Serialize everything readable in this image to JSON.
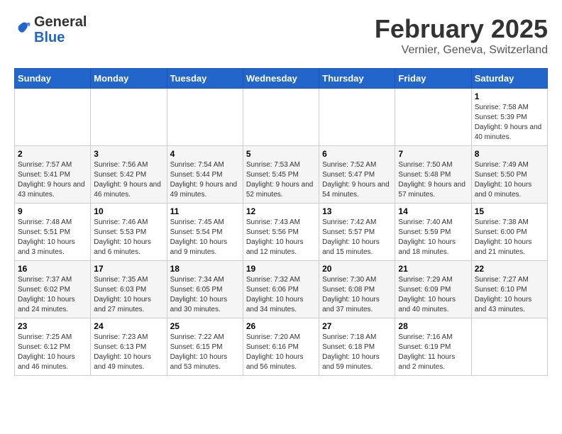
{
  "header": {
    "logo": {
      "general": "General",
      "blue": "Blue"
    },
    "title": "February 2025",
    "subtitle": "Vernier, Geneva, Switzerland"
  },
  "calendar": {
    "weekdays": [
      "Sunday",
      "Monday",
      "Tuesday",
      "Wednesday",
      "Thursday",
      "Friday",
      "Saturday"
    ],
    "weeks": [
      [
        {
          "day": "",
          "info": ""
        },
        {
          "day": "",
          "info": ""
        },
        {
          "day": "",
          "info": ""
        },
        {
          "day": "",
          "info": ""
        },
        {
          "day": "",
          "info": ""
        },
        {
          "day": "",
          "info": ""
        },
        {
          "day": "1",
          "info": "Sunrise: 7:58 AM\nSunset: 5:39 PM\nDaylight: 9 hours and 40 minutes."
        }
      ],
      [
        {
          "day": "2",
          "info": "Sunrise: 7:57 AM\nSunset: 5:41 PM\nDaylight: 9 hours and 43 minutes."
        },
        {
          "day": "3",
          "info": "Sunrise: 7:56 AM\nSunset: 5:42 PM\nDaylight: 9 hours and 46 minutes."
        },
        {
          "day": "4",
          "info": "Sunrise: 7:54 AM\nSunset: 5:44 PM\nDaylight: 9 hours and 49 minutes."
        },
        {
          "day": "5",
          "info": "Sunrise: 7:53 AM\nSunset: 5:45 PM\nDaylight: 9 hours and 52 minutes."
        },
        {
          "day": "6",
          "info": "Sunrise: 7:52 AM\nSunset: 5:47 PM\nDaylight: 9 hours and 54 minutes."
        },
        {
          "day": "7",
          "info": "Sunrise: 7:50 AM\nSunset: 5:48 PM\nDaylight: 9 hours and 57 minutes."
        },
        {
          "day": "8",
          "info": "Sunrise: 7:49 AM\nSunset: 5:50 PM\nDaylight: 10 hours and 0 minutes."
        }
      ],
      [
        {
          "day": "9",
          "info": "Sunrise: 7:48 AM\nSunset: 5:51 PM\nDaylight: 10 hours and 3 minutes."
        },
        {
          "day": "10",
          "info": "Sunrise: 7:46 AM\nSunset: 5:53 PM\nDaylight: 10 hours and 6 minutes."
        },
        {
          "day": "11",
          "info": "Sunrise: 7:45 AM\nSunset: 5:54 PM\nDaylight: 10 hours and 9 minutes."
        },
        {
          "day": "12",
          "info": "Sunrise: 7:43 AM\nSunset: 5:56 PM\nDaylight: 10 hours and 12 minutes."
        },
        {
          "day": "13",
          "info": "Sunrise: 7:42 AM\nSunset: 5:57 PM\nDaylight: 10 hours and 15 minutes."
        },
        {
          "day": "14",
          "info": "Sunrise: 7:40 AM\nSunset: 5:59 PM\nDaylight: 10 hours and 18 minutes."
        },
        {
          "day": "15",
          "info": "Sunrise: 7:38 AM\nSunset: 6:00 PM\nDaylight: 10 hours and 21 minutes."
        }
      ],
      [
        {
          "day": "16",
          "info": "Sunrise: 7:37 AM\nSunset: 6:02 PM\nDaylight: 10 hours and 24 minutes."
        },
        {
          "day": "17",
          "info": "Sunrise: 7:35 AM\nSunset: 6:03 PM\nDaylight: 10 hours and 27 minutes."
        },
        {
          "day": "18",
          "info": "Sunrise: 7:34 AM\nSunset: 6:05 PM\nDaylight: 10 hours and 30 minutes."
        },
        {
          "day": "19",
          "info": "Sunrise: 7:32 AM\nSunset: 6:06 PM\nDaylight: 10 hours and 34 minutes."
        },
        {
          "day": "20",
          "info": "Sunrise: 7:30 AM\nSunset: 6:08 PM\nDaylight: 10 hours and 37 minutes."
        },
        {
          "day": "21",
          "info": "Sunrise: 7:29 AM\nSunset: 6:09 PM\nDaylight: 10 hours and 40 minutes."
        },
        {
          "day": "22",
          "info": "Sunrise: 7:27 AM\nSunset: 6:10 PM\nDaylight: 10 hours and 43 minutes."
        }
      ],
      [
        {
          "day": "23",
          "info": "Sunrise: 7:25 AM\nSunset: 6:12 PM\nDaylight: 10 hours and 46 minutes."
        },
        {
          "day": "24",
          "info": "Sunrise: 7:23 AM\nSunset: 6:13 PM\nDaylight: 10 hours and 49 minutes."
        },
        {
          "day": "25",
          "info": "Sunrise: 7:22 AM\nSunset: 6:15 PM\nDaylight: 10 hours and 53 minutes."
        },
        {
          "day": "26",
          "info": "Sunrise: 7:20 AM\nSunset: 6:16 PM\nDaylight: 10 hours and 56 minutes."
        },
        {
          "day": "27",
          "info": "Sunrise: 7:18 AM\nSunset: 6:18 PM\nDaylight: 10 hours and 59 minutes."
        },
        {
          "day": "28",
          "info": "Sunrise: 7:16 AM\nSunset: 6:19 PM\nDaylight: 11 hours and 2 minutes."
        },
        {
          "day": "",
          "info": ""
        }
      ]
    ]
  }
}
